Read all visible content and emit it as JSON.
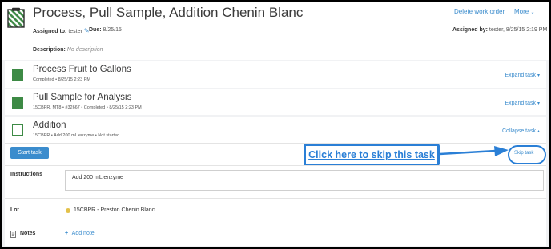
{
  "work_order": {
    "title": "Process, Pull Sample, Addition Chenin Blanc",
    "delete_label": "Delete work order",
    "more_label": "More",
    "assigned_to_label": "Assigned to:",
    "assigned_to": "tester",
    "due_label": "Due:",
    "due": "8/25/15",
    "assigned_by_label": "Assigned by:",
    "assigned_by": "tester, 8/25/15 2:19 PM",
    "description_label": "Description:",
    "description": "No description"
  },
  "tasks": [
    {
      "name": "Process Fruit to Gallons",
      "sub": "Completed  •  8/25/15  2:23 PM",
      "toggle": "Expand task",
      "status": "completed"
    },
    {
      "name": "Pull Sample for Analysis",
      "sub": "15CBPR, MT8  •  #32667  •  Completed  •  8/25/15  2:23 PM",
      "toggle": "Expand task",
      "status": "completed"
    },
    {
      "name": "Addition",
      "sub": "15CBPR  •  Add 200 mL enzyme  •  Not started",
      "toggle": "Collapse task",
      "status": "not-started"
    }
  ],
  "active_task": {
    "start_label": "Start task",
    "callout": "Click here to skip this task",
    "skip_label": "Skip task",
    "instructions_label": "Instructions",
    "instructions": "Add 200 mL enzyme",
    "lot_label": "Lot",
    "lot_value": "15CBPR - Preston Chenin Blanc",
    "notes_label": "Notes",
    "add_note_label": "Add note"
  },
  "colors": {
    "accent": "#3b8ccd",
    "complete": "#3d8a45",
    "callout": "#2a7fd6",
    "lot_dot": "#e3c14a"
  },
  "icons": [
    "work-order-icon",
    "pencil-icon",
    "chevron-down-icon",
    "chevron-up-icon",
    "arrow-right-icon",
    "notes-icon",
    "plus-icon"
  ]
}
